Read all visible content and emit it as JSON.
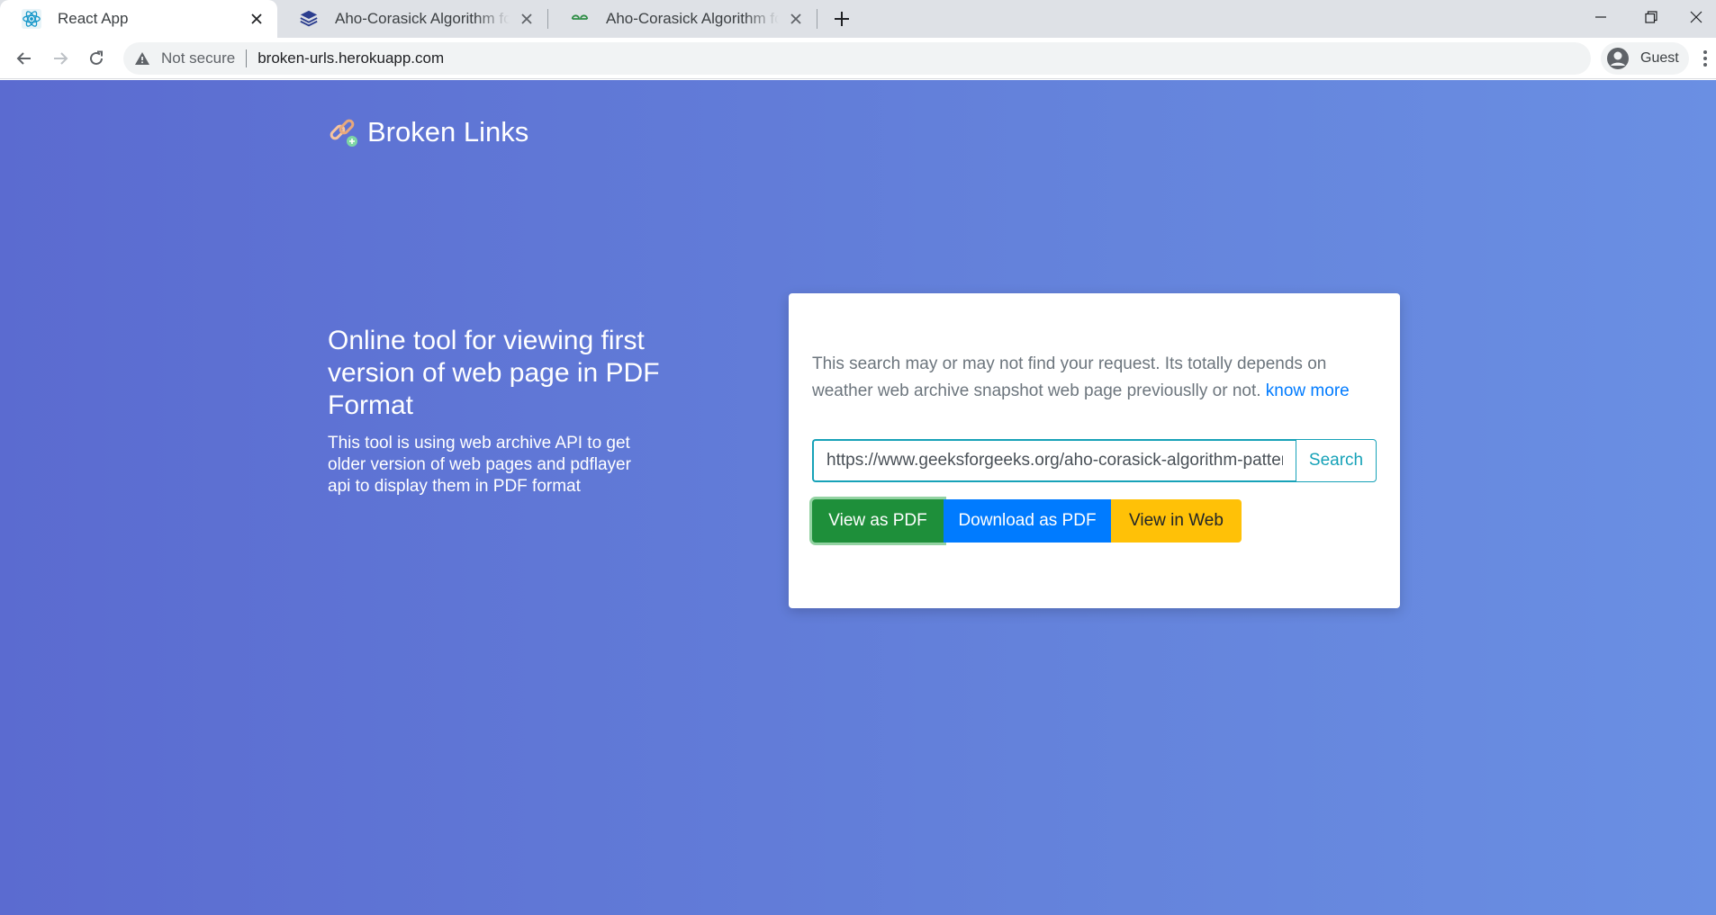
{
  "browser": {
    "tabs": [
      {
        "title": "React App",
        "favicon": "react-icon",
        "active": true
      },
      {
        "title": "Aho-Corasick Algorithm for Pattern Searching",
        "favicon": "layers-icon",
        "active": false
      },
      {
        "title": "Aho-Corasick Algorithm for Pattern Searching",
        "favicon": "geeksforgeeks-icon",
        "active": false
      }
    ],
    "security_label": "Not secure",
    "url": "broken-urls.herokuapp.com",
    "profile_label": "Guest"
  },
  "header": {
    "brand_name": "Broken Links",
    "logo": "link-icon"
  },
  "hero": {
    "title": "Online tool for viewing first version of web page in PDF Format",
    "description": "This tool is using web archive API to get older version of web pages and pdflayer api to display them in PDF format"
  },
  "card": {
    "note": "This search may or may not find your request. Its totally depends on weather web archive snapshot web page previouslly or not.",
    "note_link": "know more",
    "search_value": "https://www.geeksforgeeks.org/aho-corasick-algorithm-pattern-searching/",
    "search_label": "Search",
    "view_pdf_label": "View as PDF",
    "download_pdf_label": "Download as PDF",
    "view_web_label": "View in Web"
  },
  "colors": {
    "background_start": "#5b6bd0",
    "background_end": "#6a8fe3",
    "info": "#17a2b8",
    "success": "#1e8f3a",
    "primary": "#007bff",
    "warning": "#ffc107"
  }
}
